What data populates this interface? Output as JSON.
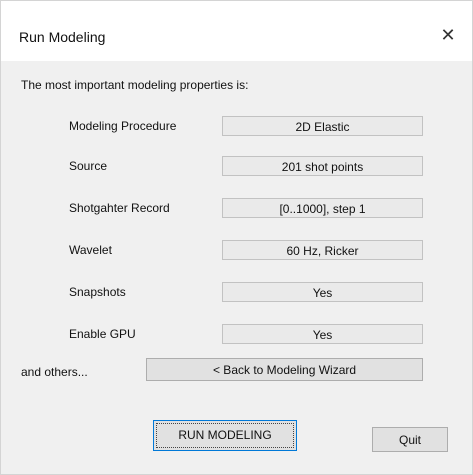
{
  "window": {
    "title": "Run Modeling",
    "close_icon": "close-icon"
  },
  "intro_text": "The most important modeling properties is:",
  "properties": [
    {
      "label": "Modeling Procedure",
      "value": "2D Elastic"
    },
    {
      "label": "Source",
      "value": "201 shot points"
    },
    {
      "label": "Shotgahter Record",
      "value": "[0..1000], step 1"
    },
    {
      "label": "Wavelet",
      "value": "60 Hz, Ricker"
    },
    {
      "label": "Snapshots",
      "value": "Yes"
    },
    {
      "label": "Enable GPU",
      "value": "Yes"
    }
  ],
  "others_label": "and others...",
  "buttons": {
    "back": "< Back to Modeling Wizard",
    "run": "RUN MODELING",
    "quit": "Quit"
  },
  "colors": {
    "dialog_bg": "#f0f0f0",
    "titlebar_bg": "#ffffff",
    "focus_border": "#0078d7"
  }
}
